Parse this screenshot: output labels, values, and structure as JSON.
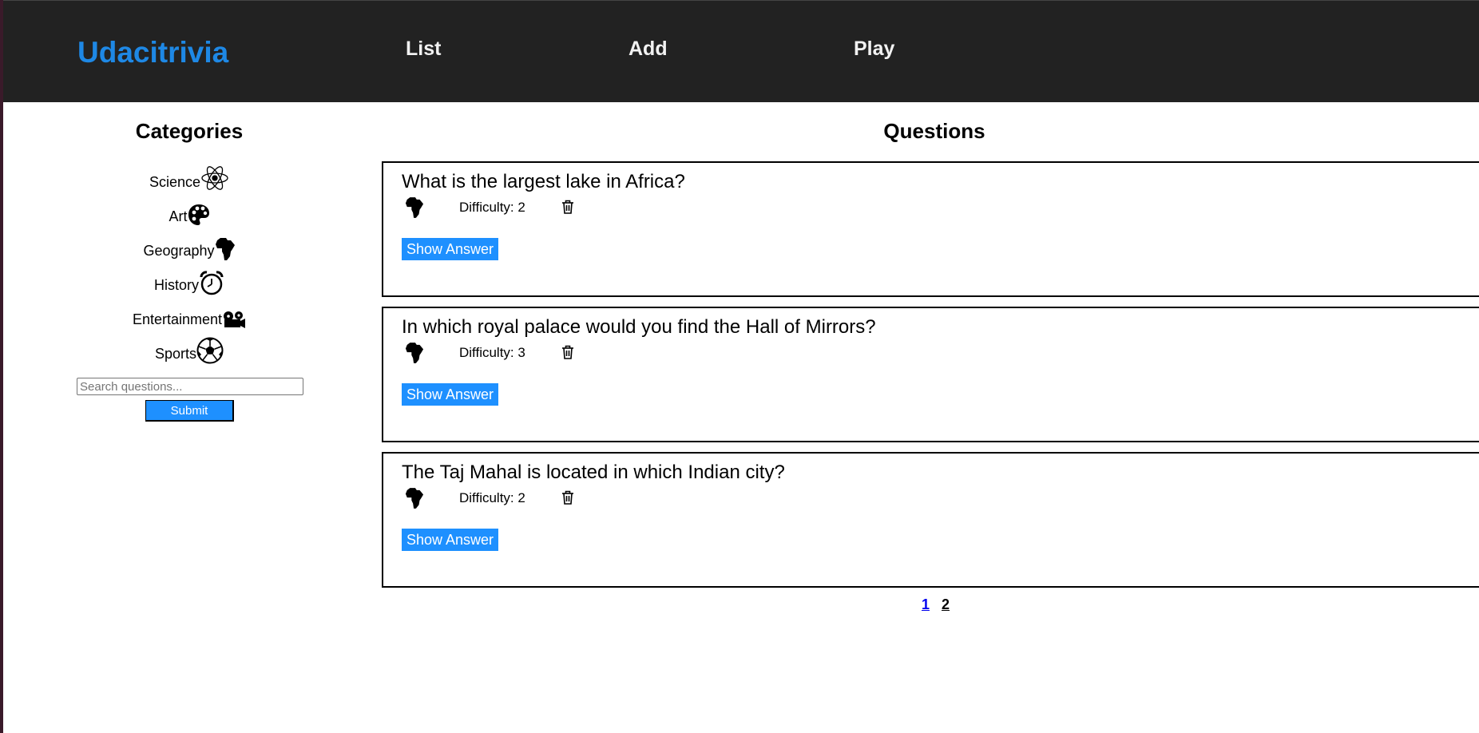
{
  "header": {
    "brand": "Udacitrivia",
    "nav": [
      {
        "label": "List"
      },
      {
        "label": "Add"
      },
      {
        "label": "Play"
      }
    ]
  },
  "sidebar": {
    "title": "Categories",
    "categories": [
      {
        "label": "Science",
        "icon": "atom-icon"
      },
      {
        "label": "Art",
        "icon": "palette-icon"
      },
      {
        "label": "Geography",
        "icon": "africa-icon"
      },
      {
        "label": "History",
        "icon": "alarm-clock-icon"
      },
      {
        "label": "Entertainment",
        "icon": "film-camera-icon"
      },
      {
        "label": "Sports",
        "icon": "soccer-ball-icon"
      }
    ],
    "search": {
      "placeholder": "Search questions...",
      "value": ""
    },
    "submit_label": "Submit"
  },
  "main": {
    "title": "Questions",
    "questions": [
      {
        "question": "What is the largest lake in Africa?",
        "difficulty": "Difficulty: 2",
        "category_icon": "africa-icon",
        "button": "Show Answer"
      },
      {
        "question": "In which royal palace would you find the Hall of Mirrors?",
        "difficulty": "Difficulty: 3",
        "category_icon": "africa-icon",
        "button": "Show Answer"
      },
      {
        "question": "The Taj Mahal is located in which Indian city?",
        "difficulty": "Difficulty: 2",
        "category_icon": "africa-icon",
        "button": "Show Answer"
      }
    ],
    "pagination": [
      {
        "label": "1",
        "active": true
      },
      {
        "label": "2",
        "active": false
      }
    ]
  },
  "colors": {
    "header_bg": "#222222",
    "brand": "#1e88e5",
    "button_bg": "#1e90ff"
  }
}
